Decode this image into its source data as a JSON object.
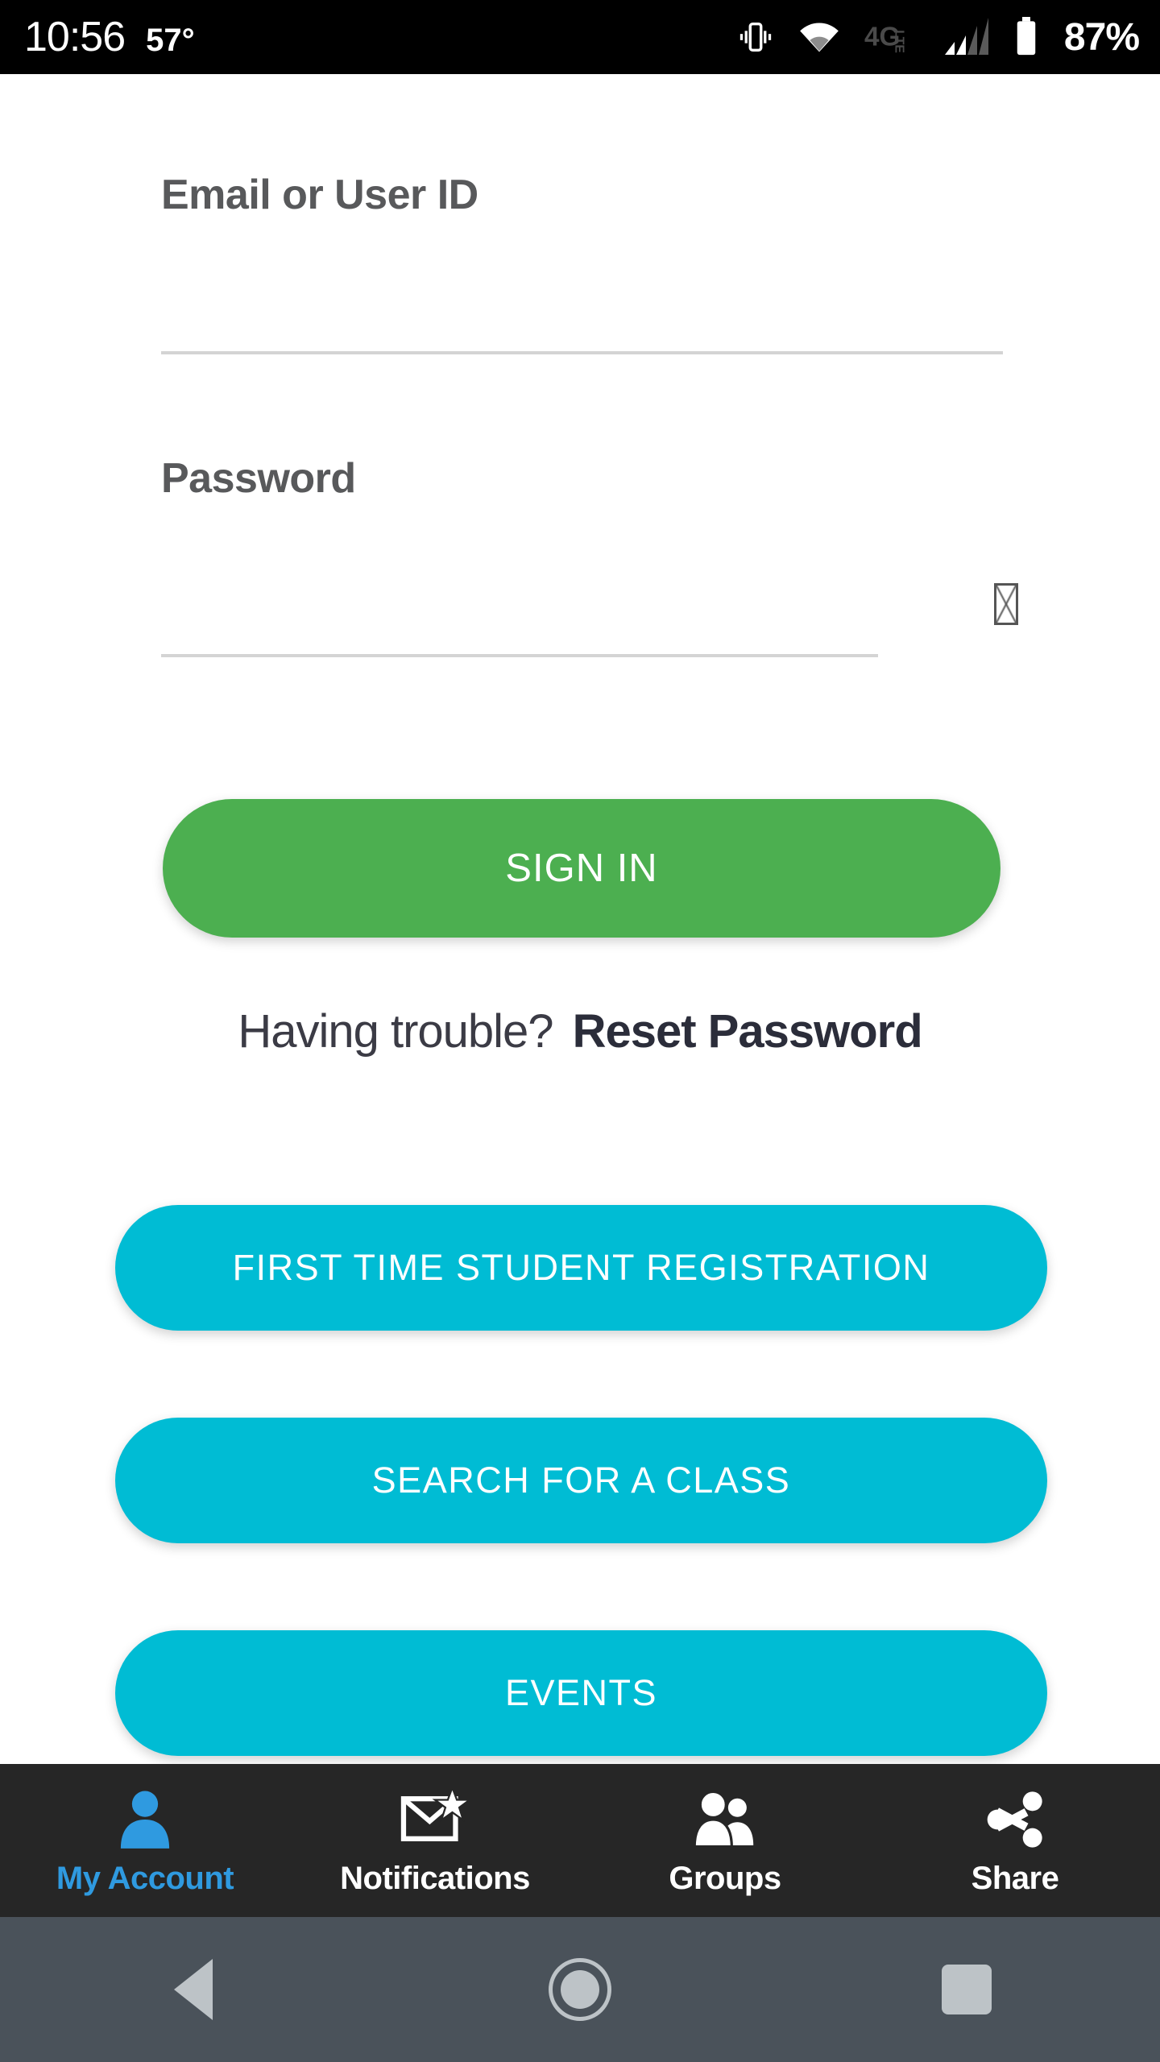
{
  "status_bar": {
    "clock": "10:56",
    "temperature": "57°",
    "battery_percent": "87%",
    "icons": [
      "vibrate-icon",
      "wifi-icon",
      "4g-lte-icon",
      "signal-bars-icon",
      "battery-icon"
    ],
    "network_label": "4G",
    "network_sub_label": "LTE",
    "background_color": "#000000"
  },
  "login_form": {
    "email": {
      "label": "Email or User ID",
      "value": "",
      "placeholder": ""
    },
    "password": {
      "label": "Password",
      "value": "",
      "placeholder": "",
      "glyph": "missing-glyph-box"
    },
    "sign_in_button": {
      "label": "SIGN IN",
      "color": "#4caf50"
    },
    "trouble_prefix": "Having trouble?",
    "reset_password_link": "Reset Password"
  },
  "action_buttons": {
    "color": "#00bcd4",
    "items": [
      {
        "label": "FIRST TIME STUDENT REGISTRATION"
      },
      {
        "label": "SEARCH FOR A CLASS"
      },
      {
        "label": "EVENTS"
      }
    ]
  },
  "bottom_nav": {
    "background_color": "#262626",
    "active_color": "#2f9ae0",
    "inactive_color": "#ffffff",
    "items": [
      {
        "label": "My Account",
        "icon": "person-icon",
        "active": true
      },
      {
        "label": "Notifications",
        "icon": "envelope-star-icon",
        "active": false
      },
      {
        "label": "Groups",
        "icon": "people-icon",
        "active": false
      },
      {
        "label": "Share",
        "icon": "share-icon",
        "active": false
      }
    ]
  },
  "system_nav": {
    "background_color": "#4a525a",
    "buttons": [
      {
        "name": "back",
        "icon": "triangle-back-icon"
      },
      {
        "name": "home",
        "icon": "circle-home-icon"
      },
      {
        "name": "recents",
        "icon": "square-recents-icon"
      }
    ]
  }
}
